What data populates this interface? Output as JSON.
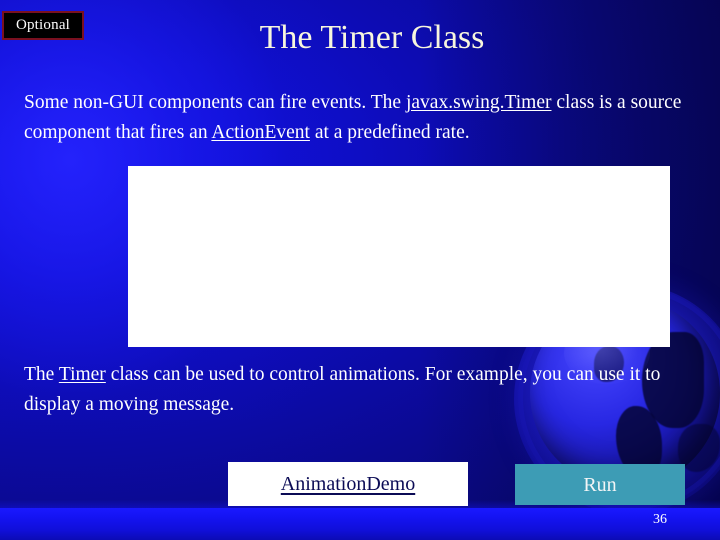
{
  "slide": {
    "badge_label": "Optional",
    "title": "The Timer Class",
    "page_number": "36",
    "paragraph_1": {
      "part_1": "Some non-GUI components can fire events. The ",
      "link_1": "javax.swing.Timer",
      "part_2": " class is a source component that fires an ",
      "link_2": "ActionEvent",
      "part_3": " at a predefined rate."
    },
    "paragraph_2": {
      "part_1": "The ",
      "link_1": "Timer",
      "part_2": " class can be used to control animations. For example, you can use it to display a moving message."
    },
    "buttons": {
      "demo_label": "AnimationDemo",
      "run_label": "Run"
    }
  },
  "colors": {
    "background_blue": "#0d0cb4",
    "background_bright_blue": "#1a19ff",
    "title_cream": "#f7f6dd",
    "badge_background": "#000000",
    "badge_border": "#7a1020",
    "run_button_teal": "#3d9cb5",
    "demo_button_white": "#ffffff",
    "demo_button_text": "#0b0b55",
    "body_text_white": "#ffffff"
  }
}
